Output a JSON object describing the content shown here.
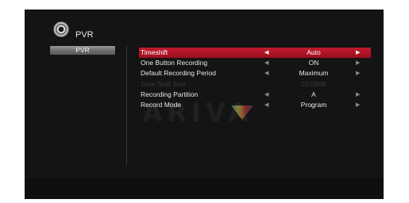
{
  "header": {
    "title": "PVR",
    "icon": "disc-icon"
  },
  "sidebar": {
    "items": [
      {
        "label": "PVR",
        "selected": true
      }
    ]
  },
  "watermark": {
    "text": "ARIVA"
  },
  "menu": {
    "rows": [
      {
        "label": "Timeshift",
        "value": "Auto",
        "state": "selected"
      },
      {
        "label": "One Button Recording",
        "value": "ON",
        "state": "normal"
      },
      {
        "label": "Default Recording Period",
        "value": "Maximum",
        "state": "normal"
      },
      {
        "label": "Time Shift Size",
        "value": "0120MB",
        "state": "disabled"
      },
      {
        "label": "Recording Partition",
        "value": "A",
        "state": "normal"
      },
      {
        "label": "Record Mode",
        "value": "Program",
        "state": "normal"
      }
    ],
    "arrow_left": "◀",
    "arrow_right": "▶"
  },
  "colors": {
    "highlight": "#b0172a",
    "screen_bg": "#141414",
    "text": "#e8e8e8",
    "disabled_text": "#3a3a3a"
  }
}
